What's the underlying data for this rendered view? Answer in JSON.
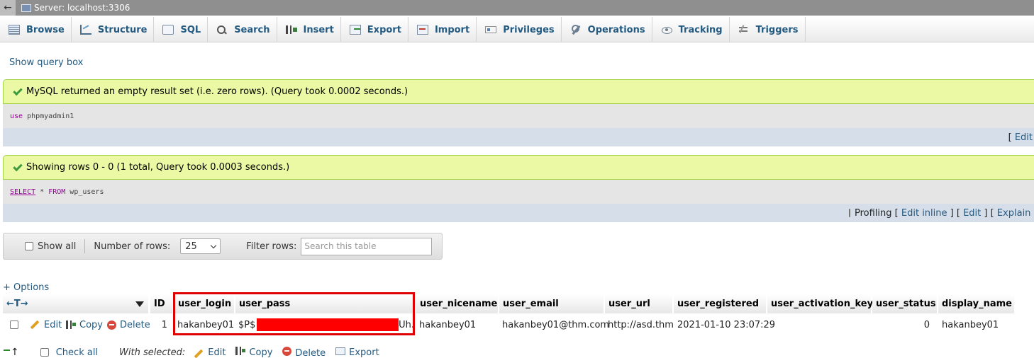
{
  "topbar": {
    "title": "Server: localhost:3306"
  },
  "tabs": [
    {
      "label": "Browse",
      "icon": "browse-icon"
    },
    {
      "label": "Structure",
      "icon": "structure-icon"
    },
    {
      "label": "SQL",
      "icon": "sql-icon"
    },
    {
      "label": "Search",
      "icon": "search-icon"
    },
    {
      "label": "Insert",
      "icon": "insert-icon"
    },
    {
      "label": "Export",
      "icon": "export-icon"
    },
    {
      "label": "Import",
      "icon": "import-icon"
    },
    {
      "label": "Privileges",
      "icon": "privileges-icon"
    },
    {
      "label": "Operations",
      "icon": "operations-icon"
    },
    {
      "label": "Tracking",
      "icon": "tracking-icon"
    },
    {
      "label": "Triggers",
      "icon": "triggers-icon"
    }
  ],
  "show_query_box": "Show query box",
  "result1": {
    "message": "MySQL returned an empty result set (i.e. zero rows). (Query took 0.0002 seconds.)",
    "sql_kw": "use",
    "sql_rest": " phpmyadmin1",
    "footer": "[ Edit"
  },
  "result2": {
    "message": "Showing rows 0 - 0 (1 total, Query took 0.0003 seconds.)",
    "sql_kw1": "SELECT",
    "sql_mid": " * ",
    "sql_kw2": "FROM",
    "sql_rest": " wp_users",
    "profiling": "Profiling",
    "bracket_open": "[",
    "edit_inline": "Edit inline",
    "sep1": "] [",
    "edit": "Edit",
    "sep2": "] [",
    "explain": "Explain SQL"
  },
  "nav": {
    "show_all": "Show all",
    "number_of_rows_label": "Number of rows:",
    "rows_value": "25",
    "filter_label": "Filter rows:",
    "filter_placeholder": "Search this table"
  },
  "options_link": "+ Options",
  "table": {
    "arrows": "←T→",
    "columns": [
      "ID",
      "user_login",
      "user_pass",
      "user_nicename",
      "user_email",
      "user_url",
      "user_registered",
      "user_activation_key",
      "user_status",
      "display_name"
    ],
    "row": {
      "actions": {
        "edit": "Edit",
        "copy": "Copy",
        "delete": "Delete"
      },
      "ID": "1",
      "user_login": "hakanbey01",
      "user_pass_prefix": "$P$",
      "user_pass_suffix": "Uh.",
      "user_nicename": "hakanbey01",
      "user_email": "hakanbey01@thm.com",
      "user_url": "http://asd.thm",
      "user_registered": "2021-01-10 23:07:29",
      "user_activation_key": "",
      "user_status": "0",
      "display_name": "hakanbey01"
    }
  },
  "bottom": {
    "check_all": "Check all",
    "with_selected": "With selected:",
    "edit": "Edit",
    "copy": "Copy",
    "delete": "Delete",
    "export": "Export"
  },
  "colors": {
    "link": "#235a81",
    "success_bg": "#ebf8a4",
    "highlight": "#e00000",
    "redaction": "#ff0000"
  }
}
